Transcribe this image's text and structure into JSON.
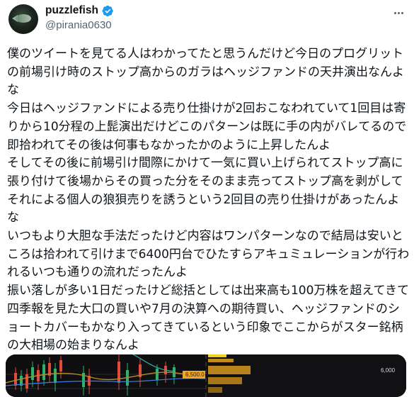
{
  "author": {
    "display_name": "puzzlefish",
    "handle": "@pirania0630"
  },
  "tweet": {
    "lines": [
      "僕のツイートを見てる人はわかってたと思うんだけど今日のプログリット",
      "の前場引け時のストップ高からのガラはヘッジファンドの天井演出なんよ",
      "な",
      "今日はヘッジファンドによる売り仕掛けが2回おこなわれていて1回目は寄",
      "りから10分程の上髭演出だけどこのパターンは既に手の内がバレてるので",
      "即拾われてその後は何事もなかったかのように上昇したんよ",
      "そしてその後に前場引け間際にかけて一気に買い上げられてストップ高に",
      "張り付けて後場からその買った分をそのまま売ってストップ高を剥がして",
      "それによる個人の狼狽売りを誘うという2回目の売り仕掛けがあったんよ",
      "な",
      "いつもより大胆な手法だったけど内容はワンパターンなので結局は安いと",
      "ころは拾われて引けまで6400円台でひたすらアキュミュレーションが行わ",
      "れるいつも通りの流れだったんよ",
      "振い落しが多い1日だったけど総括としては出来高も100万株を超えてきて",
      "四季報を見た大口の買いや7月の決算への期待買い、ヘッジファンドのシ",
      "ョートカバーもかなり入ってきているという印象でここからがスター銘柄",
      "の大相場の始まりなんよ"
    ]
  },
  "media": {
    "left_price_label": "6,500.0",
    "right_price_label": "6,000"
  },
  "colors": {
    "verified": "#1d9bf0",
    "text": "#0f1419",
    "secondary": "#536471"
  }
}
